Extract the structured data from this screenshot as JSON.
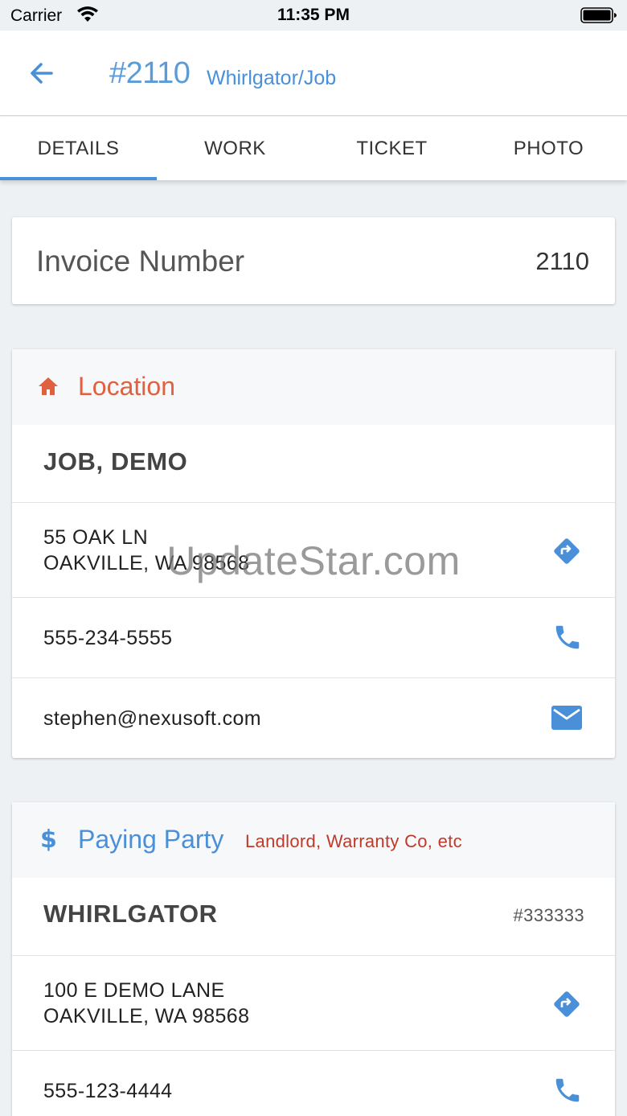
{
  "status_bar": {
    "carrier": "Carrier",
    "time": "11:35 PM"
  },
  "header": {
    "job_number": "#2110",
    "subtitle": "Whirlgator/Job"
  },
  "tabs": [
    {
      "label": "DETAILS",
      "active": true
    },
    {
      "label": "WORK",
      "active": false
    },
    {
      "label": "TICKET",
      "active": false
    },
    {
      "label": "PHOTO",
      "active": false
    }
  ],
  "invoice": {
    "label": "Invoice Number",
    "value": "2110"
  },
  "location": {
    "icon": "home-icon",
    "title": "Location",
    "name": "JOB, DEMO",
    "address_line1": "55 OAK LN",
    "address_line2": "OAKVILLE, WA 98568",
    "phone": "555-234-5555",
    "email": "stephen@nexusoft.com"
  },
  "paying_party": {
    "icon": "dollar-icon",
    "title": "Paying Party",
    "hint": "Landlord, Warranty Co, etc",
    "name": "WHIRLGATOR",
    "account": "#333333",
    "address_line1": "100 E DEMO LANE",
    "address_line2": "OAKVILLE, WA 98568",
    "phone": "555-123-4444"
  },
  "watermark": "UpdateStar.com",
  "colors": {
    "accent": "#4a90d9",
    "location": "#e0613f",
    "hint": "#c0392b",
    "background": "#eef1f4"
  }
}
